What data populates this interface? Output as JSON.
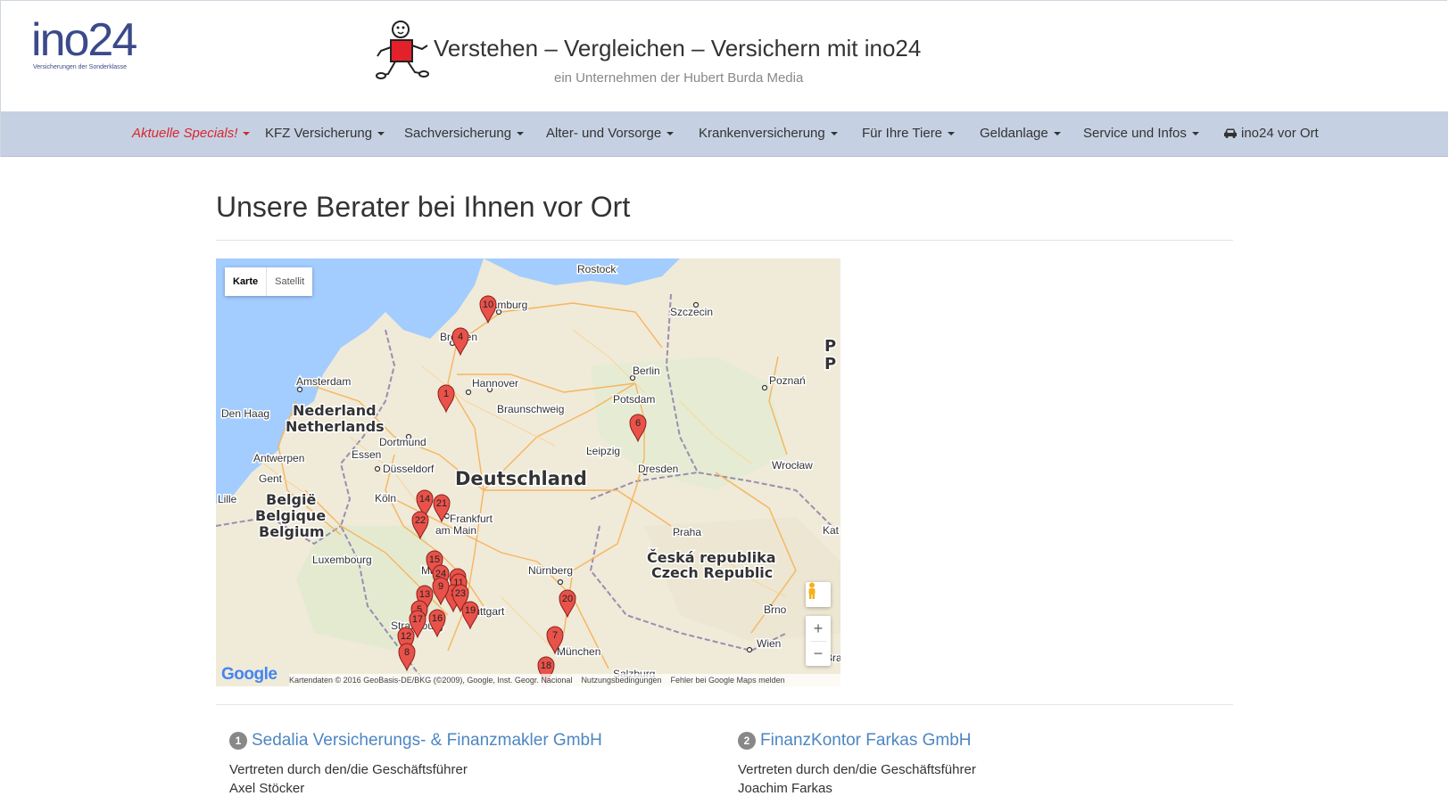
{
  "header": {
    "logo_text": "ino24",
    "logo_tagline": "Versicherungen der Sonderklasse",
    "slogan": "Verstehen – Vergleichen – Versichern mit ino24",
    "subslogan": "ein Unternehmen der Hubert Burda Media"
  },
  "nav": {
    "items": [
      {
        "label": "Aktuelle Specials!"
      },
      {
        "label": "KFZ Versicherung"
      },
      {
        "label": "Sachversicherung"
      },
      {
        "label": "Alter- und Vorsorge"
      },
      {
        "label": "Krankenversicherung"
      },
      {
        "label": "Für Ihre Tiere"
      },
      {
        "label": "Geldanlage"
      },
      {
        "label": "Service und Infos"
      },
      {
        "label": "ino24 vor Ort"
      }
    ]
  },
  "page": {
    "title": "Unsere Berater bei Ihnen vor Ort"
  },
  "map": {
    "type_controls": {
      "map": "Karte",
      "satellite": "Satellit"
    },
    "zoom_in": "+",
    "zoom_out": "−",
    "google": "Google",
    "footer": {
      "attribution": "Kartendaten © 2016 GeoBasis-DE/BKG (©2009), Google, Inst. Geogr. Nacional",
      "terms": "Nutzungsbedingungen",
      "report": "Fehler bei Google Maps melden"
    },
    "labels": {
      "rostock": "Rostock",
      "hamburg": "Hamburg",
      "szczecin": "Szczecin",
      "bremen": "Bremen",
      "berlin": "Berlin",
      "potsdam": "Potsdam",
      "amsterdam": "Amsterdam",
      "hannover": "Hannover",
      "poznan": "Poznań",
      "den_haag": "Den Haag",
      "nederland": "Nederland",
      "netherlands": "Netherlands",
      "braunschweig": "Braunschweig",
      "dortmund": "Dortmund",
      "leipzig": "Leipzig",
      "antwerpen": "Antwerpen",
      "essen": "Essen",
      "duesseldorf": "Düsseldorf",
      "gent": "Gent",
      "deutschland": "Deutschland",
      "dresden": "Dresden",
      "wroclaw": "Wrocław",
      "lille": "Lille",
      "koeln": "Köln",
      "belgie": "België",
      "belgique": "Belgique",
      "belgium": "Belgium",
      "frankfurt": "Frankfurt",
      "am_main": "am Main",
      "praha": "Praha",
      "kat": "Kat",
      "luxembourg": "Luxembourg",
      "mannheim": "Mann",
      "nuernberg": "Nürnberg",
      "ceska": "Česká republika",
      "czech": "Czech Republic",
      "stuttgart": "Stuttgart",
      "brno": "Brno",
      "strasbourg": "Strasbourg",
      "muenchen": "München",
      "wien": "Wien",
      "salzburg": "Salzburg",
      "pl_p1": "P",
      "pl_p2": "P",
      "brat": "Bra"
    },
    "markers": [
      "1",
      "4",
      "10",
      "6",
      "14",
      "21",
      "22",
      "15",
      "24",
      "2",
      "11",
      "3",
      "9",
      "13",
      "23",
      "5",
      "20",
      "17",
      "16",
      "19",
      "12",
      "7",
      "8",
      "18"
    ]
  },
  "partners": [
    {
      "number": "1",
      "name": "Sedalia Versicherungs- & Finanzmakler GmbH",
      "rep_label": "Vertreten durch den/die Geschäftsführer",
      "rep_name": "Axel Stöcker"
    },
    {
      "number": "2",
      "name": "FinanzKontor Farkas GmbH",
      "rep_label": "Vertreten durch den/die Geschäftsführer",
      "rep_name": "Joachim Farkas"
    }
  ],
  "colors": {
    "nav_bg": "#c5d1e3",
    "special_red": "#d9262e",
    "link_blue": "#4d86c2",
    "logo_blue": "#3b4a8a",
    "marker_red": "#e8524a"
  }
}
